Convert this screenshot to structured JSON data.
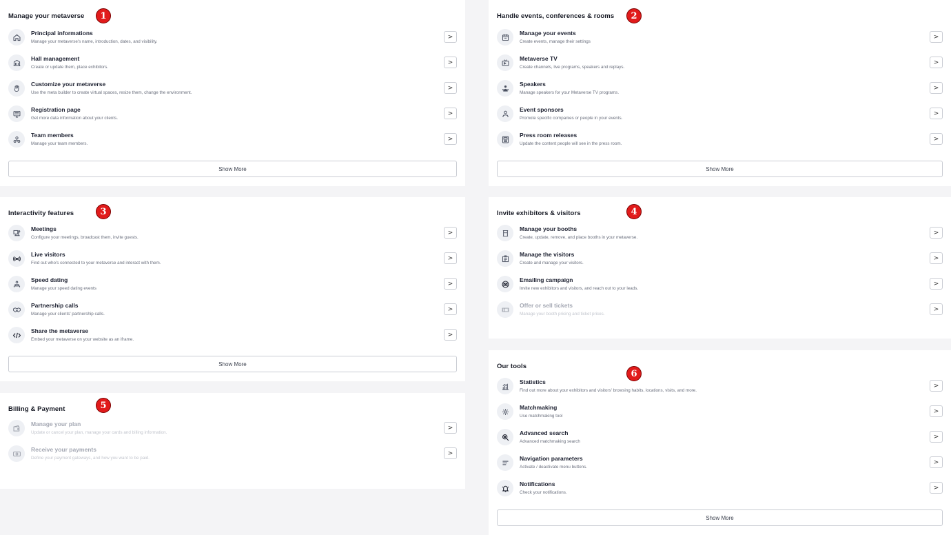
{
  "sections": {
    "manage": {
      "title": "Manage your metaverse",
      "badge": "1",
      "items": [
        {
          "title": "Principal informations",
          "desc": "Manage your metaverse's name, introduction, dates, and visibility.",
          "icon": "home-icon"
        },
        {
          "title": "Hall management",
          "desc": "Create or update them, place exhibitors.",
          "icon": "building-icon"
        },
        {
          "title": "Customize your metaverse",
          "desc": "Use the meta builder to create virtual spaces, resize them, change the environment.",
          "icon": "hand-icon"
        },
        {
          "title": "Registration page",
          "desc": "Get more data information about your clients.",
          "icon": "monitor-icon"
        },
        {
          "title": "Team members",
          "desc": "Manage your team members.",
          "icon": "team-icon"
        }
      ],
      "show_more": "Show More"
    },
    "events": {
      "title": "Handle events, conferences & rooms",
      "badge": "2",
      "items": [
        {
          "title": "Manage your events",
          "desc": "Create events, manage their settings",
          "icon": "calendar-icon"
        },
        {
          "title": "Metaverse TV",
          "desc": "Create channels, live programs, speakers and replays.",
          "icon": "tv-icon"
        },
        {
          "title": "Speakers",
          "desc": "Manage speakers for your Metaverse TV programs.",
          "icon": "speaker-icon"
        },
        {
          "title": "Event sponsors",
          "desc": "Promote specific companies or people in your events.",
          "icon": "sponsor-icon"
        },
        {
          "title": "Press room releases",
          "desc": "Update the content people will see in the press room.",
          "icon": "newspaper-icon"
        }
      ],
      "show_more": "Show More"
    },
    "interactivity": {
      "title": "Interactivity features",
      "badge": "3",
      "items": [
        {
          "title": "Meetings",
          "desc": "Configure your meetings, broadcast them, invite guests.",
          "icon": "meeting-icon"
        },
        {
          "title": "Live visitors",
          "desc": "Find out who's connected to your metaverse and interact with them.",
          "icon": "broadcast-icon"
        },
        {
          "title": "Speed dating",
          "desc": "Manage your speed dating events",
          "icon": "speed-dating-icon"
        },
        {
          "title": "Partnership calls",
          "desc": "Manage your clients' partnership calls.",
          "icon": "handshake-icon"
        },
        {
          "title": "Share the metaverse",
          "desc": "Embed your metaverse on your website as an iframe.",
          "icon": "code-icon"
        }
      ],
      "show_more": "Show More"
    },
    "invite": {
      "title": "Invite exhibitors & visitors",
      "badge": "4",
      "items": [
        {
          "title": "Manage your booths",
          "desc": "Create, update, remove, and place booths in your metaverse.",
          "icon": "booth-icon"
        },
        {
          "title": "Manage the visitors",
          "desc": "Create and manage your visitors.",
          "icon": "visitors-icon"
        },
        {
          "title": "Emailing campaign",
          "desc": "Invite new exhibitors and visitors, and reach out to your leads.",
          "icon": "email-icon"
        },
        {
          "title": "Offer or sell tickets",
          "desc": "Manage your booth pricing and ticket prices.",
          "icon": "ticket-icon",
          "disabled": true
        }
      ]
    },
    "billing": {
      "title": "Billing & Payment",
      "badge": "5",
      "items": [
        {
          "title": "Manage your plan",
          "desc": "Update or cancel your plan, manage your cards and billing information.",
          "icon": "wallet-icon",
          "disabled": true
        },
        {
          "title": "Receive your payments",
          "desc": "Define your payment gateways, and how you want to be paid.",
          "icon": "money-icon",
          "disabled": true
        }
      ]
    },
    "tools": {
      "title": "Our tools",
      "badge": "6",
      "items": [
        {
          "title": "Statistics",
          "desc": "Find out more about your exhibitors and visitors' browsing habits, locations, visits, and more.",
          "icon": "chart-icon"
        },
        {
          "title": "Matchmaking",
          "desc": "Use matchmaking tool",
          "icon": "gear-icon"
        },
        {
          "title": "Advanced search",
          "desc": "Advanced matchmaking search",
          "icon": "search-icon"
        },
        {
          "title": "Navigation parameters",
          "desc": "Activate / deactivate menu buttons.",
          "icon": "menu-lines-icon"
        },
        {
          "title": "Notifications",
          "desc": "Check your notifications.",
          "icon": "bell-icon"
        }
      ],
      "show_more": "Show More"
    }
  },
  "arrow_glyph": ">"
}
